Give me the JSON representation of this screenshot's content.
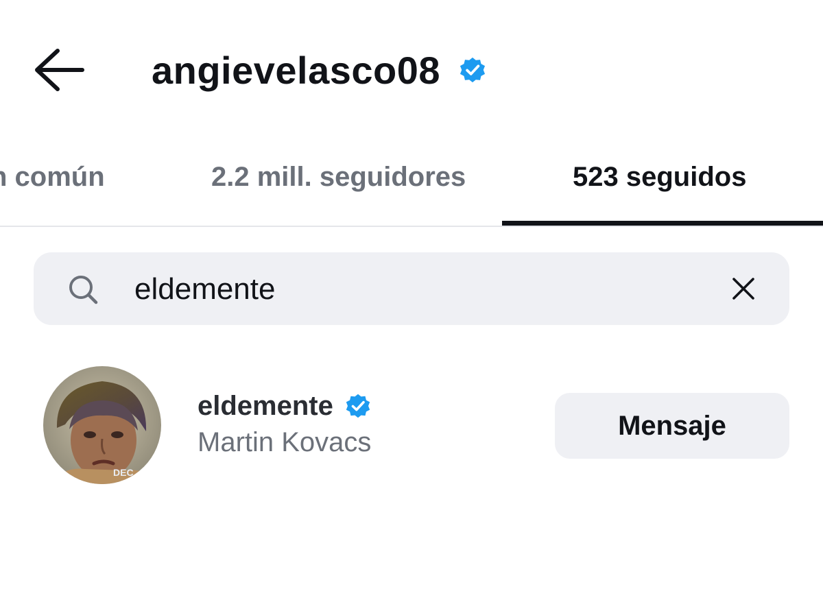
{
  "header": {
    "title": "angievelasco08",
    "back_icon": "arrow-left-icon",
    "verified_icon": "verified-badge-icon",
    "verified_color": "#1d9bf0"
  },
  "tabs": [
    {
      "label": "n común",
      "active": false
    },
    {
      "label": "2.2 mill. seguidores",
      "active": false
    },
    {
      "label": "523 seguidos",
      "active": true
    }
  ],
  "search": {
    "icon": "search-icon",
    "value": "eldemente",
    "clear_icon": "close-icon"
  },
  "results": [
    {
      "username": "eldemente",
      "verified": true,
      "full_name": "Martin Kovacs",
      "button_label": "Mensaje",
      "avatar_overlay_text": "DEC"
    }
  ],
  "colors": {
    "text_primary": "#111318",
    "text_secondary": "#6b7079",
    "surface": "#eff0f4",
    "divider": "#e4e6ea",
    "verified": "#1d9bf0"
  }
}
